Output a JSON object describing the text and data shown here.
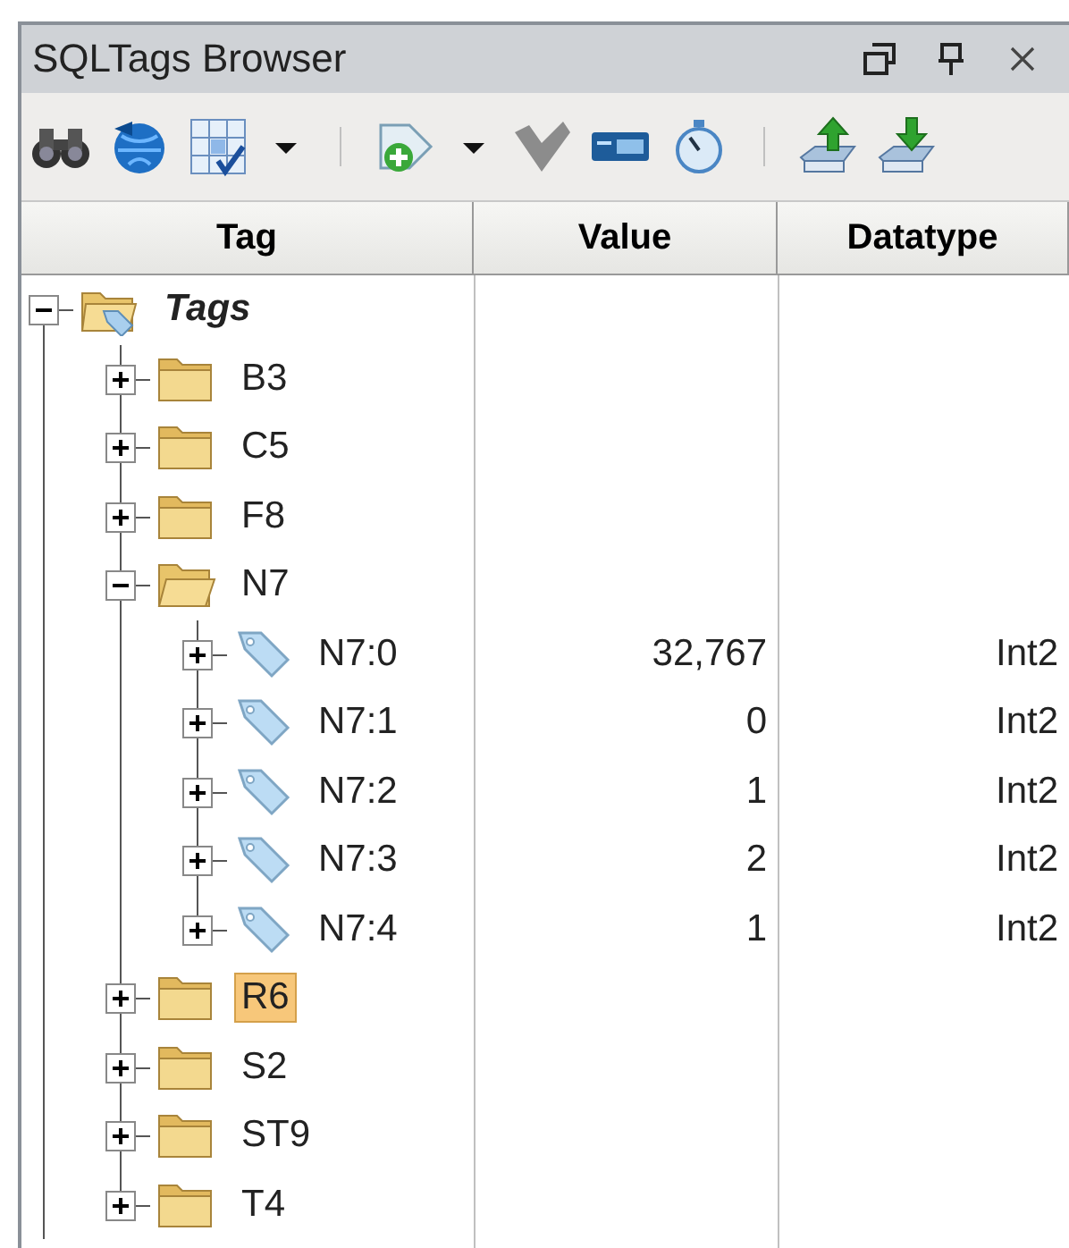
{
  "window": {
    "title": "SQLTags Browser"
  },
  "title_buttons": [
    {
      "kind": "restore"
    },
    {
      "kind": "pin"
    },
    {
      "kind": "close"
    }
  ],
  "toolbar": [
    {
      "kind": "binoculars"
    },
    {
      "kind": "globe"
    },
    {
      "kind": "grid"
    },
    {
      "kind": "caret"
    },
    {
      "kind": "separator"
    },
    {
      "kind": "tag-add"
    },
    {
      "kind": "caret"
    },
    {
      "kind": "check"
    },
    {
      "kind": "device"
    },
    {
      "kind": "stopwatch"
    },
    {
      "kind": "separator"
    },
    {
      "kind": "upload"
    },
    {
      "kind": "download"
    }
  ],
  "table": {
    "columns": [
      "Tag",
      "Value",
      "Datatype"
    ],
    "tree": [
      {
        "label": "Tags",
        "kind": "root",
        "expanded": true,
        "selected": false,
        "children": [
          {
            "label": "B3",
            "kind": "folder",
            "expanded": false,
            "selected": false
          },
          {
            "label": "C5",
            "kind": "folder",
            "expanded": false,
            "selected": false
          },
          {
            "label": "F8",
            "kind": "folder",
            "expanded": false,
            "selected": false
          },
          {
            "label": "N7",
            "kind": "folder",
            "expanded": true,
            "selected": false,
            "children": [
              {
                "label": "N7:0",
                "kind": "tag",
                "expanded": false,
                "selected": false,
                "value": "32,767",
                "datatype": "Int2"
              },
              {
                "label": "N7:1",
                "kind": "tag",
                "expanded": false,
                "selected": false,
                "value": "0",
                "datatype": "Int2"
              },
              {
                "label": "N7:2",
                "kind": "tag",
                "expanded": false,
                "selected": false,
                "value": "1",
                "datatype": "Int2"
              },
              {
                "label": "N7:3",
                "kind": "tag",
                "expanded": false,
                "selected": false,
                "value": "2",
                "datatype": "Int2"
              },
              {
                "label": "N7:4",
                "kind": "tag",
                "expanded": false,
                "selected": false,
                "value": "1",
                "datatype": "Int2"
              }
            ]
          },
          {
            "label": "R6",
            "kind": "folder",
            "expanded": false,
            "selected": true
          },
          {
            "label": "S2",
            "kind": "folder",
            "expanded": false,
            "selected": false
          },
          {
            "label": "ST9",
            "kind": "folder",
            "expanded": false,
            "selected": false
          },
          {
            "label": "T4",
            "kind": "folder",
            "expanded": false,
            "selected": false
          }
        ]
      }
    ]
  }
}
